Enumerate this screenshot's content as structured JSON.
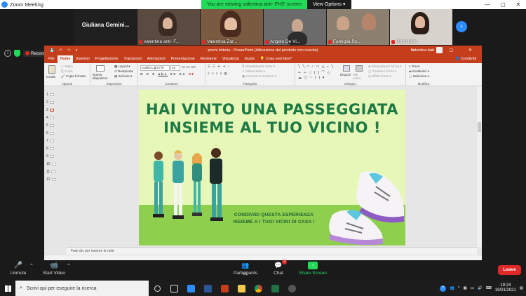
{
  "zoom": {
    "title": "Zoom Meeting",
    "viewing_banner": "You are viewing valentina anti- FHS' screen",
    "view_options": "View Options",
    "recording_label": "Recording"
  },
  "participants": [
    {
      "name": "Giuliana  Gemini...",
      "muted": false,
      "video": false
    },
    {
      "name": "valentina anti- F...",
      "muted": true,
      "video": true
    },
    {
      "name": "Valentina Zar...",
      "muted": true,
      "video": true
    },
    {
      "name": "Angelo De Vi...",
      "muted": true,
      "video": true
    },
    {
      "name": "Famiglia Ro...",
      "muted": true,
      "video": true
    },
    {
      "name": "Pizzichett...",
      "muted": true,
      "video": true
    }
  ],
  "ppt": {
    "title": "premi lotteria - PowerPoint (Attivazione del prodotto non riuscita)",
    "account": "Valentina Anti",
    "tabs": [
      "File",
      "Home",
      "Inserisci",
      "Progettazione",
      "Transizioni",
      "Animazioni",
      "Presentazione",
      "Revisione",
      "Visualizza",
      "Guida"
    ],
    "active_tab": "Home",
    "tell_me": "Cosa vuoi fare?",
    "share": "Condividi",
    "ribbon": {
      "paste": "Incolla",
      "cut": "Taglia",
      "copy": "Copia",
      "format_painter": "Copia formato",
      "clipboard": "Appunti",
      "new_slide": "Nuova diapositiva",
      "layout": "Layout",
      "reset": "Reimposta",
      "section": "Sezione",
      "slides": "Diapositive",
      "font_name": "Carlito Light (Tit",
      "font_size": "44",
      "font": "Carattere",
      "text_direction": "Orientamento testo",
      "align_text": "Allinea testo",
      "convert_smartart": "Converti in SmartArt",
      "paragraph": "Paragrafo",
      "arrange": "Disponi",
      "quick_styles": "Stili veloci",
      "shape_fill": "Riempimento forma",
      "shape_outline": "Contorno forma",
      "shape_effects": "Effetti forma",
      "drawing": "Disegno",
      "find": "Trova",
      "replace": "Sostituisci",
      "select": "Seleziona",
      "editing": "Modifica"
    },
    "slide_numbers": [
      "1",
      "2",
      "3",
      "4",
      "5",
      "6",
      "7",
      "8",
      "9",
      "10",
      "11",
      "12"
    ],
    "selected_slide": "3",
    "notes_placeholder": "Fare clic per inserire le note"
  },
  "slide": {
    "headline_line1": "HAI VINTO UNA PASSEGGIATA",
    "headline_line2": "INSIEME AL TUO VICINO !",
    "sub_line1": "CONDIVIDI QUESTA ESPERIENZA",
    "sub_line2": "INSIEME A I TUOI VICINI DI CASA !",
    "colors": {
      "background": "#e6f7b8",
      "ground": "#8ed04e",
      "headline": "#1d7a44"
    }
  },
  "meeting_toolbar": {
    "unmute": "Unmute",
    "start_video": "Start Video",
    "participants": "Participants",
    "participants_count": "61",
    "chat": "Chat",
    "chat_badge": "2",
    "share_screen": "Share Screen",
    "leave": "Leave"
  },
  "taskbar": {
    "search_placeholder": "Scrivi qui per eseguire la ricerca",
    "time": "19:24",
    "date": "19/01/2021"
  }
}
